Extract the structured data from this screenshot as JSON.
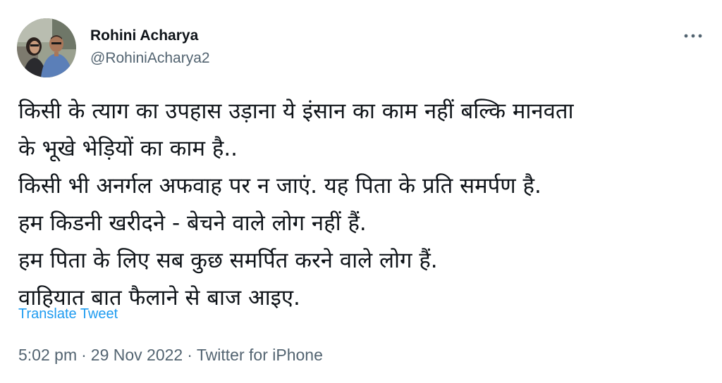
{
  "tweet": {
    "author": {
      "display_name": "Rohini Acharya",
      "handle": "@RohiniAcharya2"
    },
    "more_icon": "more-horizontal-icon",
    "body_lines": [
      "किसी के त्याग का उपहास उड़ाना ये इंसान का काम नहीं बल्कि मानवता",
      "के भूखे भेड़ियों का काम है..",
      "किसी भी अनर्गल अफवाह पर न जाएं. यह पिता के प्रति समर्पण है.",
      "हम किडनी खरीदने - बेचने वाले लोग नहीं हैं.",
      "हम पिता के लिए सब कुछ समर्पित करने वाले लोग हैं.",
      "वाहियात बात फैलाने से बाज आइए."
    ],
    "translate_label": "Translate Tweet",
    "time": "5:02 pm",
    "date": "29 Nov 2022",
    "separator": "·",
    "source": "Twitter for iPhone"
  },
  "colors": {
    "text_primary": "#0f1419",
    "text_secondary": "#536471",
    "link": "#1d9bf0"
  }
}
